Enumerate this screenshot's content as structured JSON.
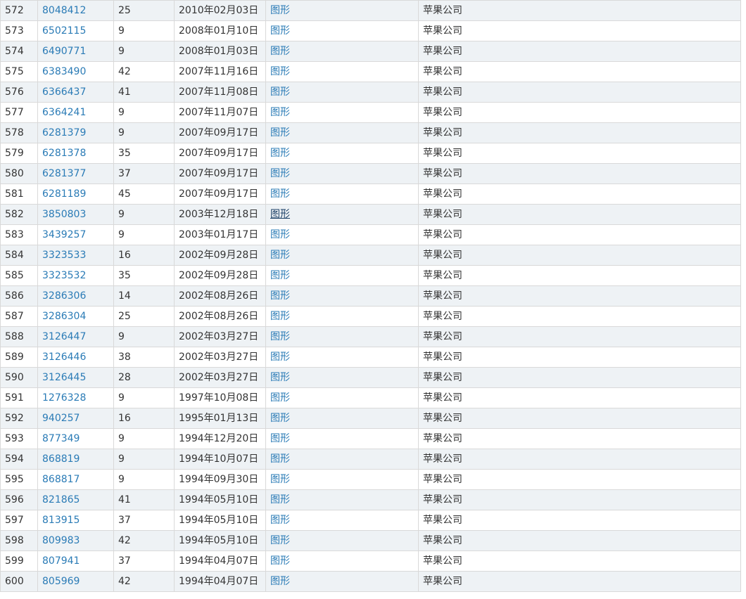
{
  "rows": [
    {
      "no": "572",
      "reg": "8048412",
      "cls": "25",
      "date": "2010年02月03日",
      "type": "图形",
      "owner": "苹果公司"
    },
    {
      "no": "573",
      "reg": "6502115",
      "cls": "9",
      "date": "2008年01月10日",
      "type": "图形",
      "owner": "苹果公司"
    },
    {
      "no": "574",
      "reg": "6490771",
      "cls": "9",
      "date": "2008年01月03日",
      "type": "图形",
      "owner": "苹果公司"
    },
    {
      "no": "575",
      "reg": "6383490",
      "cls": "42",
      "date": "2007年11月16日",
      "type": "图形",
      "owner": "苹果公司"
    },
    {
      "no": "576",
      "reg": "6366437",
      "cls": "41",
      "date": "2007年11月08日",
      "type": "图形",
      "owner": "苹果公司"
    },
    {
      "no": "577",
      "reg": "6364241",
      "cls": "9",
      "date": "2007年11月07日",
      "type": "图形",
      "owner": "苹果公司"
    },
    {
      "no": "578",
      "reg": "6281379",
      "cls": "9",
      "date": "2007年09月17日",
      "type": "图形",
      "owner": "苹果公司"
    },
    {
      "no": "579",
      "reg": "6281378",
      "cls": "35",
      "date": "2007年09月17日",
      "type": "图形",
      "owner": "苹果公司"
    },
    {
      "no": "580",
      "reg": "6281377",
      "cls": "37",
      "date": "2007年09月17日",
      "type": "图形",
      "owner": "苹果公司"
    },
    {
      "no": "581",
      "reg": "6281189",
      "cls": "45",
      "date": "2007年09月17日",
      "type": "图形",
      "owner": "苹果公司"
    },
    {
      "no": "582",
      "reg": "3850803",
      "cls": "9",
      "date": "2003年12月18日",
      "type": "图形",
      "owner": "苹果公司",
      "hovered": true
    },
    {
      "no": "583",
      "reg": "3439257",
      "cls": "9",
      "date": "2003年01月17日",
      "type": "图形",
      "owner": "苹果公司"
    },
    {
      "no": "584",
      "reg": "3323533",
      "cls": "16",
      "date": "2002年09月28日",
      "type": "图形",
      "owner": "苹果公司"
    },
    {
      "no": "585",
      "reg": "3323532",
      "cls": "35",
      "date": "2002年09月28日",
      "type": "图形",
      "owner": "苹果公司"
    },
    {
      "no": "586",
      "reg": "3286306",
      "cls": "14",
      "date": "2002年08月26日",
      "type": "图形",
      "owner": "苹果公司"
    },
    {
      "no": "587",
      "reg": "3286304",
      "cls": "25",
      "date": "2002年08月26日",
      "type": "图形",
      "owner": "苹果公司"
    },
    {
      "no": "588",
      "reg": "3126447",
      "cls": "9",
      "date": "2002年03月27日",
      "type": "图形",
      "owner": "苹果公司"
    },
    {
      "no": "589",
      "reg": "3126446",
      "cls": "38",
      "date": "2002年03月27日",
      "type": "图形",
      "owner": "苹果公司"
    },
    {
      "no": "590",
      "reg": "3126445",
      "cls": "28",
      "date": "2002年03月27日",
      "type": "图形",
      "owner": "苹果公司"
    },
    {
      "no": "591",
      "reg": "1276328",
      "cls": "9",
      "date": "1997年10月08日",
      "type": "图形",
      "owner": "苹果公司"
    },
    {
      "no": "592",
      "reg": "940257",
      "cls": "16",
      "date": "1995年01月13日",
      "type": "图形",
      "owner": "苹果公司"
    },
    {
      "no": "593",
      "reg": "877349",
      "cls": "9",
      "date": "1994年12月20日",
      "type": "图形",
      "owner": "苹果公司"
    },
    {
      "no": "594",
      "reg": "868819",
      "cls": "9",
      "date": "1994年10月07日",
      "type": "图形",
      "owner": "苹果公司"
    },
    {
      "no": "595",
      "reg": "868817",
      "cls": "9",
      "date": "1994年09月30日",
      "type": "图形",
      "owner": "苹果公司"
    },
    {
      "no": "596",
      "reg": "821865",
      "cls": "41",
      "date": "1994年05月10日",
      "type": "图形",
      "owner": "苹果公司"
    },
    {
      "no": "597",
      "reg": "813915",
      "cls": "37",
      "date": "1994年05月10日",
      "type": "图形",
      "owner": "苹果公司"
    },
    {
      "no": "598",
      "reg": "809983",
      "cls": "42",
      "date": "1994年05月10日",
      "type": "图形",
      "owner": "苹果公司"
    },
    {
      "no": "599",
      "reg": "807941",
      "cls": "37",
      "date": "1994年04月07日",
      "type": "图形",
      "owner": "苹果公司"
    },
    {
      "no": "600",
      "reg": "805969",
      "cls": "42",
      "date": "1994年04月07日",
      "type": "图形",
      "owner": "苹果公司"
    }
  ],
  "colors": {
    "link": "#2a7bb6",
    "row_alt": "#eef2f5",
    "border": "#d9d9d9",
    "text": "#333333"
  }
}
